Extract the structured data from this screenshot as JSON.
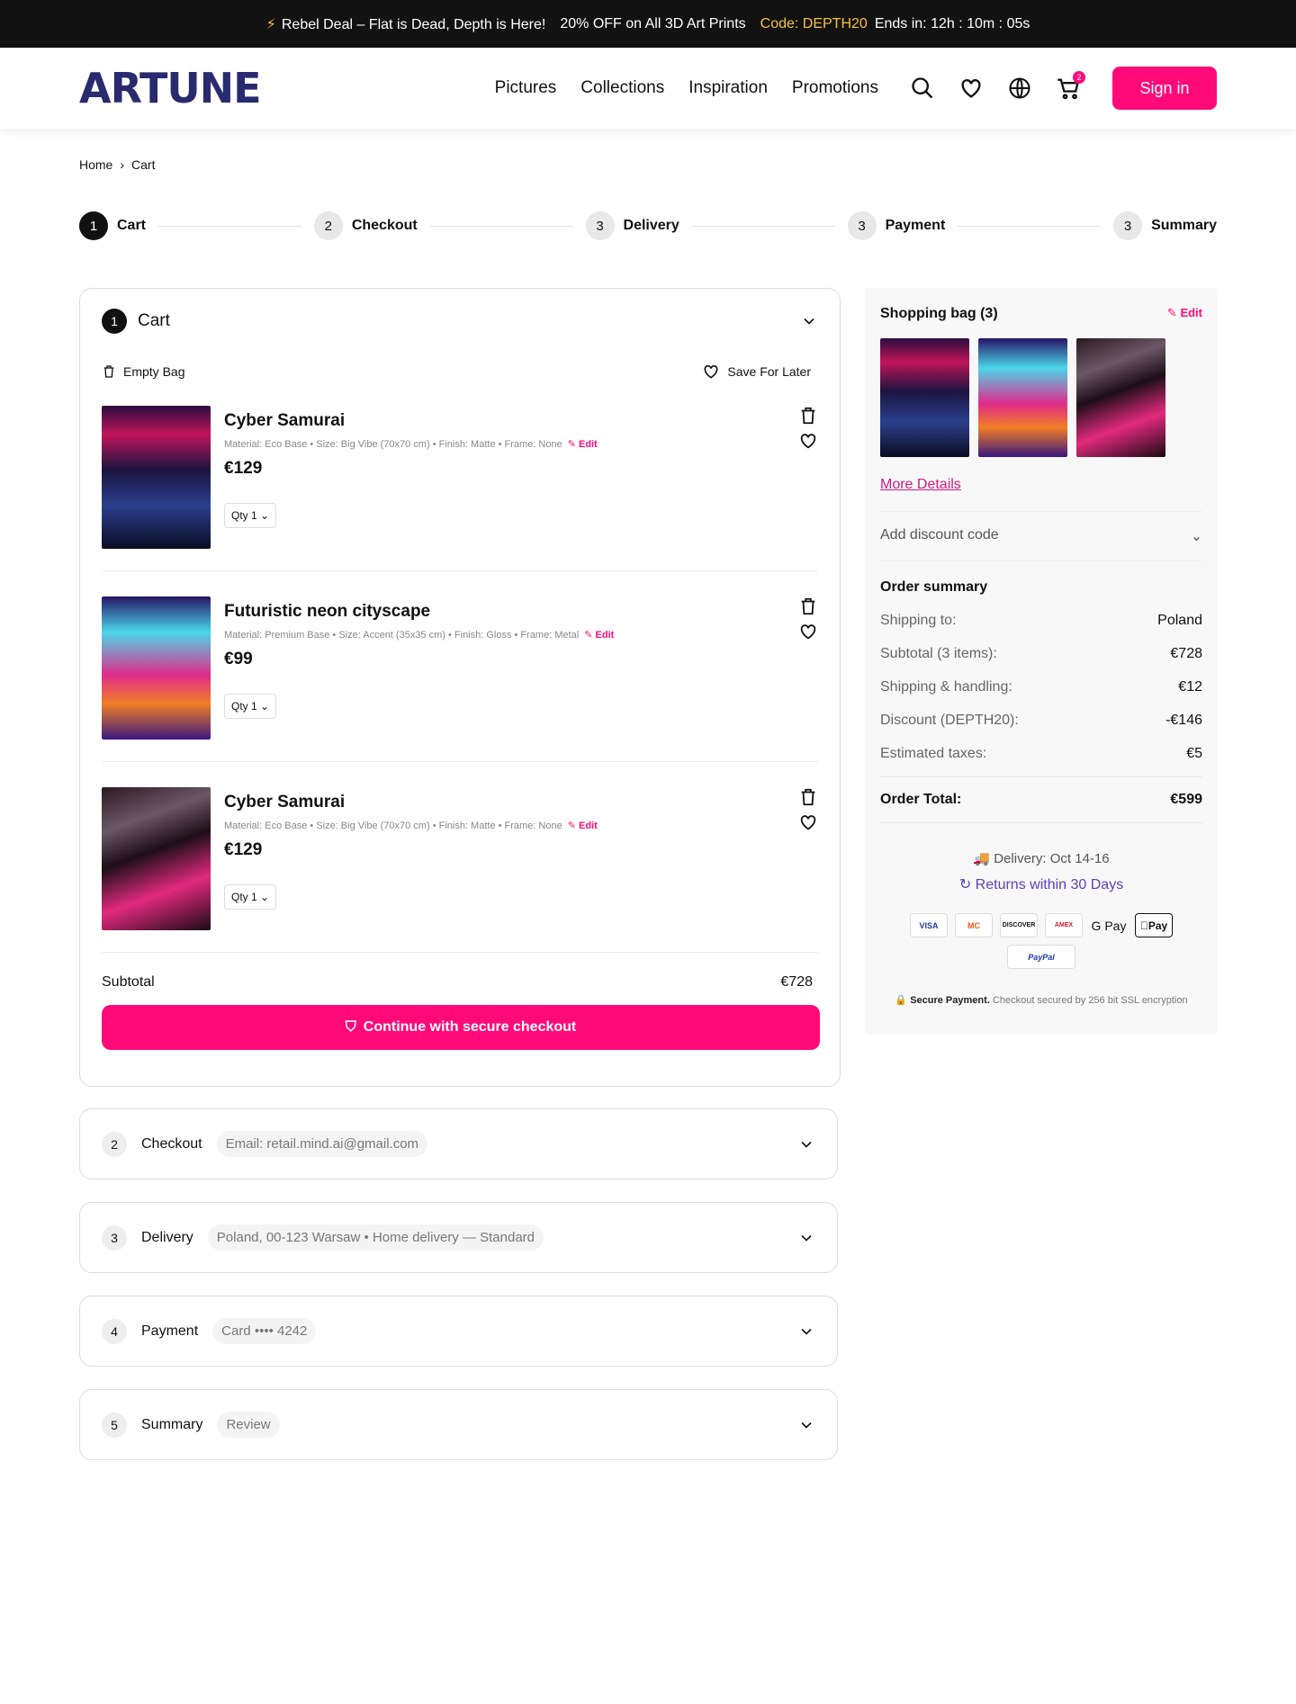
{
  "promo": {
    "lead": "Rebel Deal – Flat is Dead, Depth is Here!",
    "offer": "20% OFF on All 3D Art Prints",
    "code": "Code: DEPTH20",
    "timer": "Ends in: 12h : 10m : 05s"
  },
  "brand": {
    "logo": "ARTUNE"
  },
  "nav": [
    "Pictures",
    "Collections",
    "Inspiration",
    "Promotions"
  ],
  "header": {
    "cart_count": "2",
    "signin": "Sign in"
  },
  "breadcrumb": [
    "Home",
    "Cart"
  ],
  "steps": [
    {
      "n": "1",
      "label": "Cart"
    },
    {
      "n": "2",
      "label": "Checkout"
    },
    {
      "n": "3",
      "label": "Delivery"
    },
    {
      "n": "3",
      "label": "Payment"
    },
    {
      "n": "3",
      "label": "Summary"
    }
  ],
  "cart": {
    "n": "1",
    "title": "Cart",
    "empty": "Empty Bag",
    "save": "Save For Later",
    "subtotal_label": "Subtotal",
    "subtotal": "€728",
    "cta": "Continue with secure checkout",
    "items": [
      {
        "title": "Cyber Samurai",
        "meta": "Material: Eco Base • Size: Big Vibe (70x70 cm) • Finish: Matte • Frame: None",
        "edit": "Edit",
        "price": "€129",
        "qty": "Qty 1"
      },
      {
        "title": "Futuristic neon cityscape",
        "meta": "Material: Premium Base • Size: Accent (35x35 cm) • Finish: Gloss • Frame: Metal",
        "edit": "Edit",
        "price": "€99",
        "qty": "Qty 1"
      },
      {
        "title": "Cyber Samurai",
        "meta": "Material: Eco Base • Size: Big Vibe (70x70 cm) • Finish: Matte • Frame: None",
        "edit": "Edit",
        "price": "€129",
        "qty": "Qty 1"
      }
    ]
  },
  "accordion": [
    {
      "n": "2",
      "label": "Checkout",
      "pill": "Email: retail.mind.ai@gmail.com"
    },
    {
      "n": "3",
      "label": "Delivery",
      "pill": "Poland, 00-123 Warsaw • Home delivery — Standard"
    },
    {
      "n": "4",
      "label": "Payment",
      "pill": "Card •••• 4242"
    },
    {
      "n": "5",
      "label": "Summary",
      "pill": "Review"
    }
  ],
  "side": {
    "title": "Shopping bag (3)",
    "edit": "Edit",
    "more": "More Details",
    "discount": "Add discount code",
    "order_summary": "Order summary",
    "rows": [
      [
        "Shipping to:",
        "Poland"
      ],
      [
        "Subtotal (3 items):",
        "€728"
      ],
      [
        "Shipping & handling:",
        "€12"
      ],
      [
        "Discount (DEPTH20):",
        "-€146"
      ],
      [
        "Estimated taxes:",
        "€5"
      ]
    ],
    "total_label": "Order Total:",
    "total": "€599",
    "delivery": "Delivery: Oct 14-16",
    "returns": "Returns within 30 Days",
    "payments": [
      "VISA",
      "MC",
      "DISCOVER",
      "AMEX",
      "G Pay",
      "Pay",
      "PayPal"
    ],
    "secure_bold": "Secure Payment.",
    "secure_text": "Checkout secured by 256 bit SSL encryption"
  },
  "colors": {
    "accent": "#ff0a78",
    "promo_bg": "#121212",
    "code": "#f5c242"
  }
}
